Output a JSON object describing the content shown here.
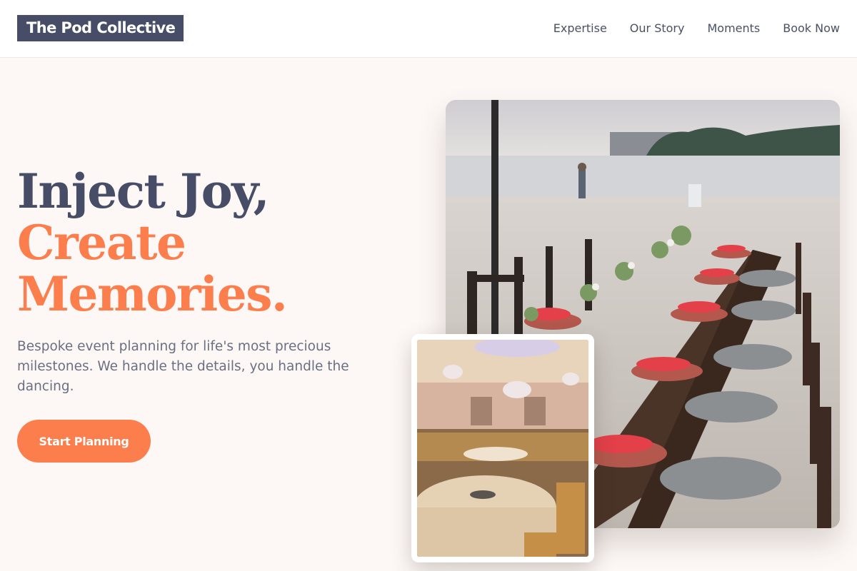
{
  "brand": {
    "name": "The Pod Collective"
  },
  "nav": {
    "items": [
      {
        "label": "Expertise"
      },
      {
        "label": "Our Story"
      },
      {
        "label": "Moments"
      },
      {
        "label": "Book Now"
      }
    ]
  },
  "hero": {
    "title_line1": "Inject Joy,",
    "title_line2": "Create",
    "title_line3": "Memories.",
    "subtitle": "Bespoke event planning for life's most precious milestones. We handle the details, you handle the dancing.",
    "cta_label": "Start Planning"
  },
  "colors": {
    "brand_navy": "#474c67",
    "accent_orange": "#fd7e4d",
    "background": "#fdf8f6"
  }
}
